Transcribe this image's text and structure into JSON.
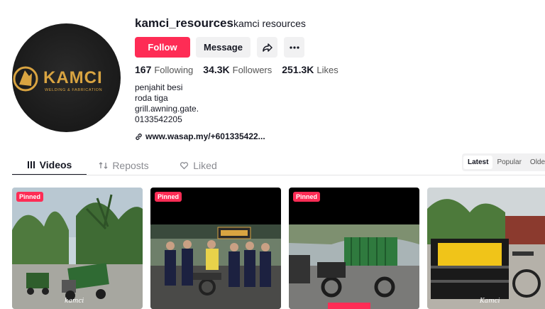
{
  "profile": {
    "username": "kamci_resources",
    "nickname": "kamci resources",
    "avatar_logo": "KAMCI",
    "avatar_tagline": "WELDING & FABRICATION",
    "follow_label": "Follow",
    "message_label": "Message",
    "share_icon": "share-icon",
    "more_icon": "more-icon"
  },
  "stats": {
    "following_value": "167",
    "following_label": "Following",
    "followers_value": "34.3K",
    "followers_label": "Followers",
    "likes_value": "251.3K",
    "likes_label": "Likes"
  },
  "bio": [
    "penjahit besi",
    "roda tiga",
    "grill.awning.gate.",
    "0133542205"
  ],
  "link": "www.wasap.my/+601335422...",
  "tabs": [
    {
      "label": "Videos",
      "icon": "grid-icon"
    },
    {
      "label": "Reposts",
      "icon": "repost-icon"
    },
    {
      "label": "Liked",
      "icon": "heart-icon"
    }
  ],
  "sort": [
    "Latest",
    "Popular",
    "Oldest"
  ],
  "videos": [
    {
      "pinned": "Pinned",
      "watermark": "kamci"
    },
    {
      "pinned": "Pinned"
    },
    {
      "pinned": "Pinned"
    },
    {
      "watermark": "Kamci"
    }
  ]
}
